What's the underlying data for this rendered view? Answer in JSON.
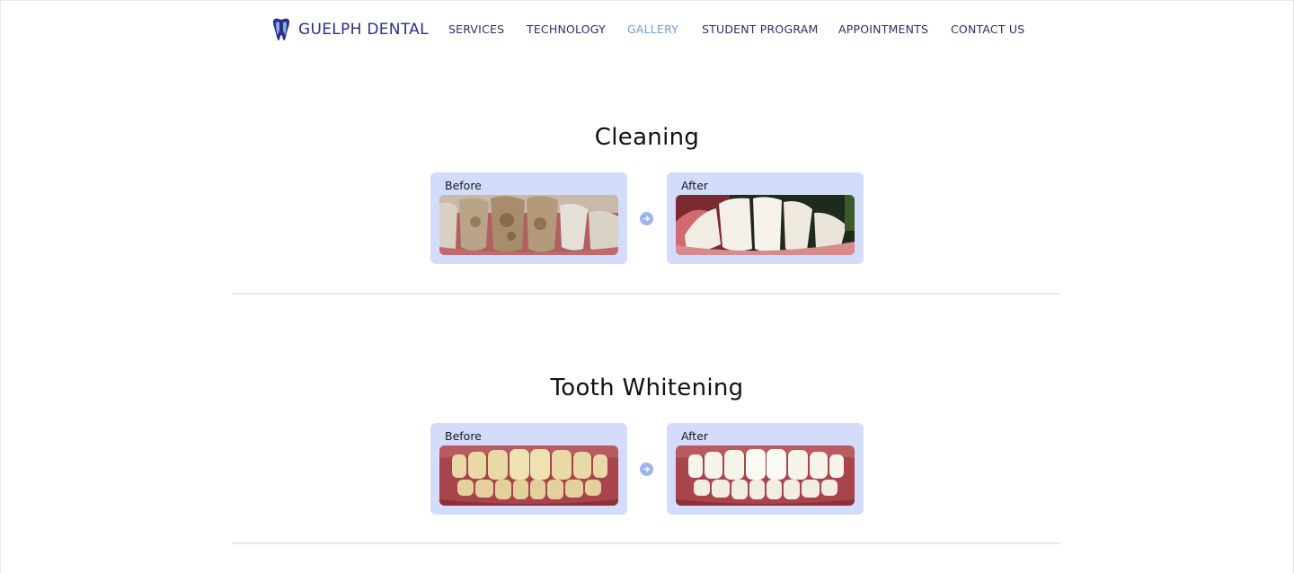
{
  "header": {
    "brand": "GUELPH DENTAL",
    "logo_icon": "tooth-icon",
    "nav": [
      {
        "label": "SERVICES",
        "active": false
      },
      {
        "label": "TECHNOLOGY",
        "active": false
      },
      {
        "label": "GALLERY",
        "active": true
      },
      {
        "label": "STUDENT PROGRAM",
        "active": false
      },
      {
        "label": "APPOINTMENTS",
        "active": false
      },
      {
        "label": "CONTACT US",
        "active": false
      }
    ]
  },
  "colors": {
    "brand": "#2b2f88",
    "nav_text": "#2a2f6e",
    "nav_active": "#6f9fd8",
    "card_bg": "#d3dcfb",
    "arrow": "#9bb6ef",
    "divider": "#e3ebf1"
  },
  "gallery": [
    {
      "title": "Cleaning",
      "before_label": "Before",
      "after_label": "After",
      "arrow_icon": "arrow-right-icon"
    },
    {
      "title": "Tooth Whitening",
      "before_label": "Before",
      "after_label": "After",
      "arrow_icon": "arrow-right-icon"
    }
  ]
}
